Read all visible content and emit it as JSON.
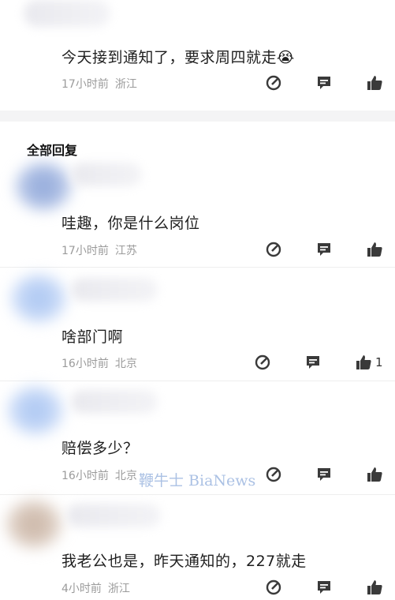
{
  "top_comment": {
    "text": "今天接到通知了，要求周四就走",
    "emoji": "😭",
    "time": "17小时前",
    "location": "浙江"
  },
  "section_title": "全部回复",
  "replies": [
    {
      "text": "哇趣，你是什么岗位",
      "time": "17小时前",
      "location": "江苏",
      "likes": ""
    },
    {
      "text": "啥部门啊",
      "time": "16小时前",
      "location": "北京",
      "likes": "1"
    },
    {
      "text": "赔偿多少？",
      "time": "16小时前",
      "location": "北京",
      "likes": ""
    },
    {
      "text": "我老公也是，昨天通知的，227就走",
      "time": "4小时前",
      "location": "浙江",
      "likes": ""
    }
  ],
  "watermark": "鞭牛士 BiaNews",
  "icons": [
    "edit-icon",
    "comment-icon",
    "thumbs-up-icon"
  ],
  "colors": {
    "meta": "#9b9b9b",
    "icon": "#3a3a3a",
    "divider": "#f4f4f5",
    "watermark": "#9db7e0"
  }
}
